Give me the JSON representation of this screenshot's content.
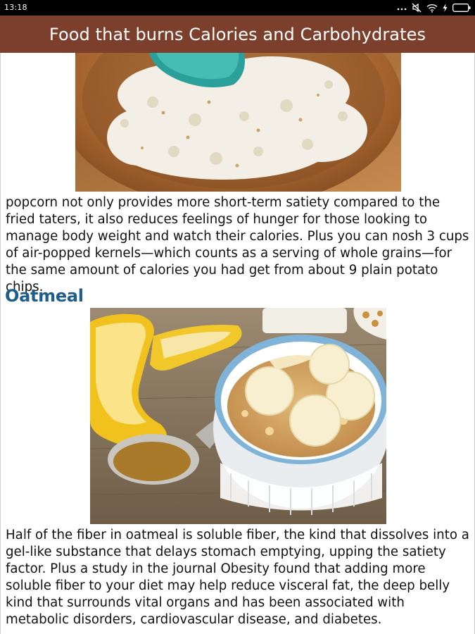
{
  "status_bar": {
    "time": "13:18",
    "icons": [
      "more-dots-icon",
      "mute-icon",
      "wifi-icon",
      "charging-icon",
      "battery-icon"
    ]
  },
  "header": {
    "title": "Food that burns Calories and Carbohydrates",
    "background_color": "#7b3f2b"
  },
  "article": {
    "popcorn_image": "popcorn-bowl-image",
    "popcorn_paragraph": "popcorn not only provides more short-term satiety compared to the fried taters, it also reduces feelings of hunger for those looking to manage body weight and watch their calories. Plus you can nosh 3 cups of air-popped kernels—which counts as a serving of whole grains—for the same amount of calories you had get from about 9 plain potato chips.",
    "oatmeal_heading": "Oatmeal",
    "oatmeal_image": "oatmeal-with-banana-image",
    "oatmeal_paragraph": "Half of the fiber in oatmeal is soluble fiber, the kind that dissolves into a gel-like substance that delays stomach emptying, upping the satiety factor. Plus a study in the journal Obesity found that adding more soluble fiber to your diet may help reduce visceral fat, the deep belly kind that surrounds vital organs and has been associated with metabolic disorders, cardiovascular disease, and diabetes.",
    "heading_color": "#1f5d8a"
  }
}
